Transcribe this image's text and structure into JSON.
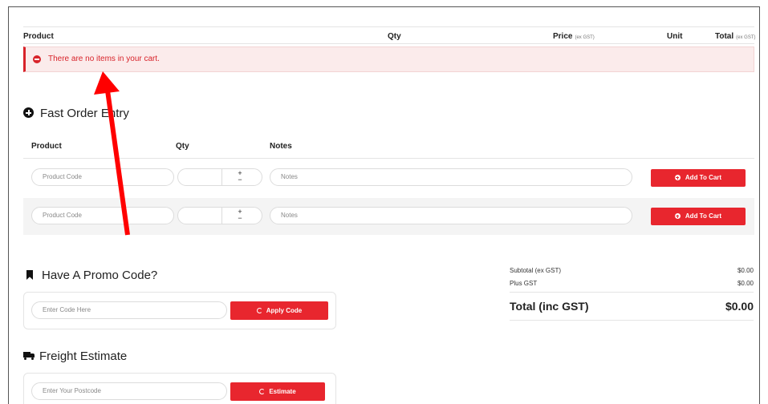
{
  "cart": {
    "headers": {
      "product": "Product",
      "qty": "Qty",
      "price": "Price",
      "price_note": "(ex GST)",
      "unit": "Unit",
      "total": "Total",
      "total_note": "(ex GST)"
    },
    "empty_message": "There are no items in your cart."
  },
  "fast_order": {
    "title": "Fast Order Entry",
    "headers": {
      "product": "Product",
      "qty": "Qty",
      "notes": "Notes"
    },
    "rows": [
      {
        "product_placeholder": "Product Code",
        "notes_placeholder": "Notes",
        "plus": "+",
        "minus": "−",
        "button": "Add To Cart"
      },
      {
        "product_placeholder": "Product Code",
        "notes_placeholder": "Notes",
        "plus": "+",
        "minus": "−",
        "button": "Add To Cart"
      }
    ]
  },
  "promo": {
    "title": "Have A Promo Code?",
    "placeholder": "Enter Code Here",
    "button": "Apply Code"
  },
  "freight": {
    "title": "Freight Estimate",
    "placeholder": "Enter Your Postcode",
    "button": "Estimate"
  },
  "totals": {
    "subtotal_label": "Subtotal (ex GST)",
    "subtotal_value": "$0.00",
    "gst_label": "Plus GST",
    "gst_value": "$0.00",
    "total_label": "Total (inc GST)",
    "total_value": "$0.00"
  },
  "colors": {
    "accent": "#e8262e",
    "annotation_arrow": "#ff0000"
  }
}
